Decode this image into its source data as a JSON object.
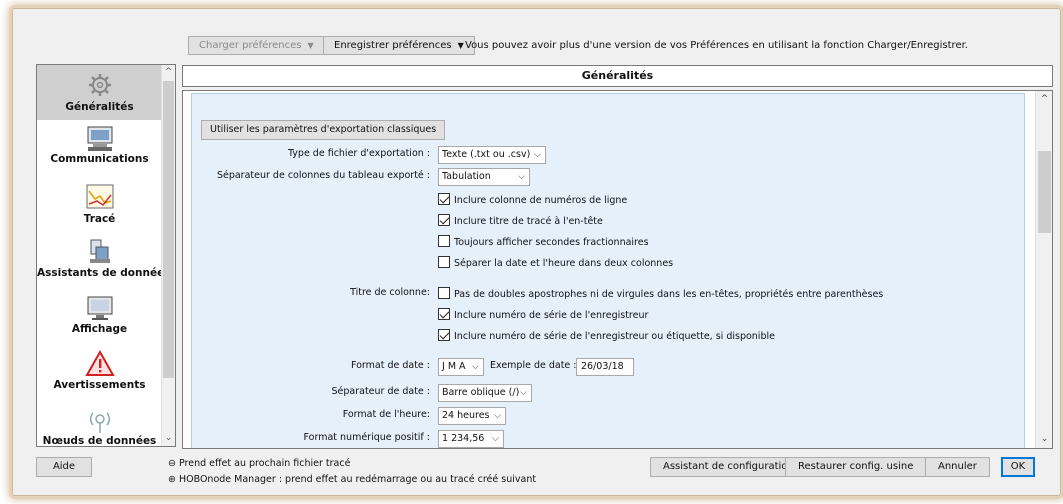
{
  "toolbar": {
    "load_label": "Charger préférences",
    "save_label": "Enregistrer préférences",
    "info": "Vous pouvez avoir plus d'une version de vos Préférences en utilisant la fonction Charger/Enregistrer."
  },
  "sidebar": {
    "items": [
      {
        "label": "Généralités",
        "icon": "gear-icon"
      },
      {
        "label": "Communications",
        "icon": "computer-icon"
      },
      {
        "label": "Tracé",
        "icon": "chart-icon"
      },
      {
        "label": "Assistants de données",
        "icon": "data-assistant-icon"
      },
      {
        "label": "Affichage",
        "icon": "monitor-icon"
      },
      {
        "label": "Avertissements",
        "icon": "warning-icon"
      },
      {
        "label": "Nœuds de données",
        "icon": "wireless-node-icon"
      }
    ]
  },
  "main": {
    "title": "Généralités",
    "classic_export_button": "Utiliser les paramètres d'exportation classiques",
    "file_type_label": "Type de fichier d'exportation :",
    "file_type_value": "Texte (.txt ou .csv)",
    "separator_label": "Séparateur de colonnes du tableau exporté :",
    "separator_value": "Tabulation",
    "checkboxes_export": [
      {
        "label": "Inclure colonne de numéros de ligne",
        "checked": true
      },
      {
        "label": "Inclure titre de tracé à l'en-tête",
        "checked": true
      },
      {
        "label": "Toujours afficher secondes fractionnaires",
        "checked": false
      },
      {
        "label": "Séparer la date et l'heure dans deux colonnes",
        "checked": false
      }
    ],
    "column_title_label": "Titre de colonne:",
    "checkboxes_column": [
      {
        "label": "Pas de doubles apostrophes ni de virgules dans les en-têtes, propriétés entre parenthèses",
        "checked": false
      },
      {
        "label": "Inclure numéro de série de l'enregistreur",
        "checked": true
      },
      {
        "label": "Inclure numéro de série de l'enregistreur ou étiquette, si disponible",
        "checked": true
      }
    ],
    "date_format_label": "Format de date :",
    "date_format_value": "J M A",
    "date_example_label": "Exemple de date :",
    "date_example_value": "26/03/18",
    "date_separator_label": "Séparateur de date :",
    "date_separator_value": "Barre oblique (/)",
    "time_format_label": "Format de l'heure:",
    "time_format_value": "24 heures",
    "number_format_label": "Format numérique positif :",
    "number_format_value": "1 234,56"
  },
  "footer": {
    "help": "Aide",
    "legend1": "Prend effet au prochain fichier tracé",
    "legend2": "HOBOnode Manager : prend effet au redémarrage ou au tracé créé suivant",
    "setup_assistant": "Assistant de configuration",
    "restore": "Restaurer config. usine",
    "cancel": "Annuler",
    "ok": "OK"
  }
}
